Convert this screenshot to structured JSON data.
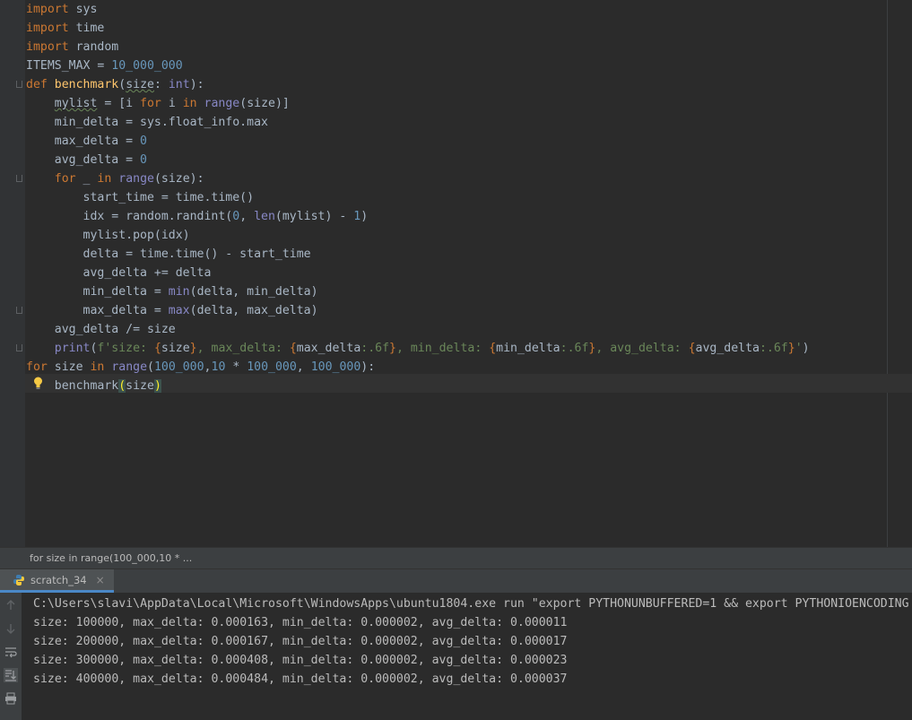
{
  "editor": {
    "lines": [
      [
        "import",
        " sys"
      ],
      [
        "import",
        " time"
      ],
      [
        "import",
        " random"
      ],
      [
        "ITEMS_MAX = ",
        "10_000_000"
      ],
      [
        "def",
        " ",
        "benchmark",
        "(",
        "size",
        ": ",
        "int",
        "):"
      ],
      [
        "    ",
        "mylist",
        " = [i ",
        "for",
        " i ",
        "in",
        " ",
        "range",
        "(size)]"
      ],
      [
        "    min_delta = sys.float_info.max"
      ],
      [
        "    max_delta = ",
        "0"
      ],
      [
        "    avg_delta = ",
        "0"
      ],
      [
        "    ",
        "for",
        " _ ",
        "in",
        " ",
        "range",
        "(size):"
      ],
      [
        "        start_time = time.time()"
      ],
      [
        "        idx = random.randint(",
        "0",
        ", ",
        "len",
        "(mylist) - ",
        "1",
        ")"
      ],
      [
        "        mylist.pop(idx)"
      ],
      [
        "        delta = time.time() - start_time"
      ],
      [
        "        avg_delta += delta"
      ],
      [
        "        min_delta = ",
        "min",
        "(delta, min_delta)"
      ],
      [
        "        max_delta = ",
        "max",
        "(delta, max_delta)"
      ],
      [
        "    avg_delta /= size"
      ],
      [
        "    ",
        "print",
        "(",
        "f'size: ",
        "{",
        "size",
        "}",
        ", max_delta: ",
        "{",
        "max_delta",
        ":.6f",
        "}",
        ", min_delta: ",
        "{",
        "min_delta",
        ":.6f",
        "}",
        ", avg_delta: ",
        "{",
        "avg_delta",
        ":.6f",
        "}",
        "'",
        ")"
      ],
      [
        "for",
        " size ",
        "in",
        " ",
        "range",
        "(",
        "100_000",
        ",",
        "10",
        " * ",
        "100_000",
        ", ",
        "100_000",
        "):"
      ],
      [
        "    benchmark",
        "(",
        "size",
        ")"
      ]
    ]
  },
  "breadcrumb": "for size in range(100_000,10 * ...",
  "run": {
    "tab_label": "scratch_34",
    "tab_close": "×",
    "output": [
      "C:\\Users\\slavi\\AppData\\Local\\Microsoft\\WindowsApps\\ubuntu1804.exe run \"export PYTHONUNBUFFERED=1 && export PYTHONIOENCODING",
      "size: 100000, max_delta: 0.000163, min_delta: 0.000002, avg_delta: 0.000011",
      "size: 200000, max_delta: 0.000167, min_delta: 0.000002, avg_delta: 0.000017",
      "size: 300000, max_delta: 0.000408, min_delta: 0.000002, avg_delta: 0.000023",
      "size: 400000, max_delta: 0.000484, min_delta: 0.000002, avg_delta: 0.000037"
    ]
  },
  "icons": {
    "python": "python-icon",
    "bulb": "lightbulb-icon",
    "up": "arrow-up-icon",
    "down": "arrow-down-icon",
    "wrap": "soft-wrap-icon",
    "scroll": "scroll-to-end-icon",
    "print": "print-icon"
  }
}
